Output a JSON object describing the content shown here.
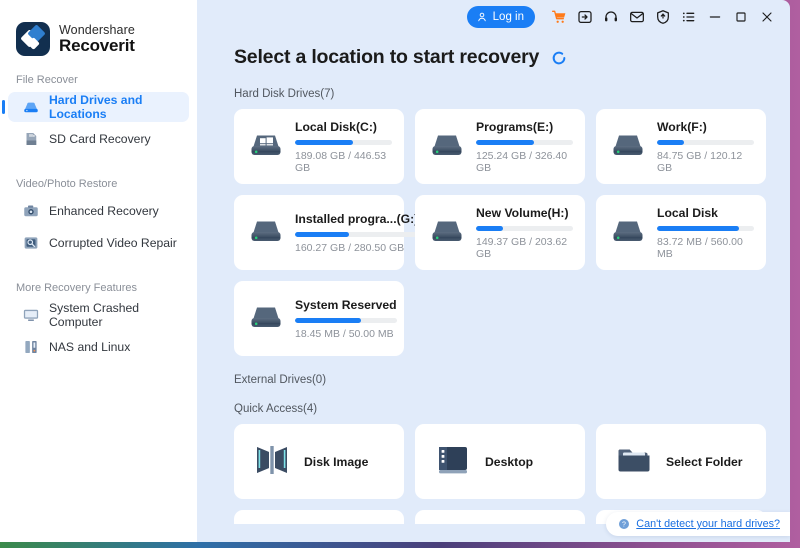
{
  "titlebar": {
    "login_label": "Log in",
    "icons": [
      {
        "name": "cart-icon",
        "label": "Cart"
      },
      {
        "name": "activate-icon",
        "label": "Activate"
      },
      {
        "name": "headset-support-icon",
        "label": "Support"
      },
      {
        "name": "mail-icon",
        "label": "Feedback"
      },
      {
        "name": "update-shield-icon",
        "label": "Update"
      },
      {
        "name": "menu-list-icon",
        "label": "Menu"
      },
      {
        "name": "minimize-icon",
        "label": "Minimize"
      },
      {
        "name": "maximize-icon",
        "label": "Maximize"
      },
      {
        "name": "close-icon",
        "label": "Close"
      }
    ]
  },
  "sidebar": {
    "brand_line1": "Wondershare",
    "brand_line2": "Recoverit",
    "sections": [
      {
        "label": "File Recover",
        "items": [
          {
            "label": "Hard Drives and Locations",
            "icon": "hard-drive-icon",
            "active": true
          },
          {
            "label": "SD Card Recovery",
            "icon": "sd-card-icon",
            "active": false
          }
        ]
      },
      {
        "label": "Video/Photo Restore",
        "items": [
          {
            "label": "Enhanced Recovery",
            "icon": "camera-icon",
            "active": false
          },
          {
            "label": "Corrupted Video Repair",
            "icon": "video-repair-icon",
            "active": false
          }
        ]
      },
      {
        "label": "More Recovery Features",
        "items": [
          {
            "label": "System Crashed Computer",
            "icon": "monitor-icon",
            "active": false
          },
          {
            "label": "NAS and Linux",
            "icon": "nas-server-icon",
            "active": false
          }
        ]
      }
    ]
  },
  "main": {
    "title": "Select a location to start recovery",
    "refresh_icon": "refresh-icon",
    "groups": {
      "hard_disk_label": "Hard Disk Drives(7)",
      "external_label": "External Drives(0)",
      "quick_access_label": "Quick Access(4)"
    },
    "drives": [
      {
        "name": "Local Disk(C:)",
        "capacity": "189.08 GB / 446.53 GB",
        "percent": 60,
        "icon": "windows-drive-icon"
      },
      {
        "name": "Programs(E:)",
        "capacity": "125.24 GB / 326.40 GB",
        "percent": 60,
        "icon": "drive-icon"
      },
      {
        "name": "Work(F:)",
        "capacity": "84.75 GB / 120.12 GB",
        "percent": 28,
        "icon": "drive-icon"
      },
      {
        "name": "Installed progra...(G:)",
        "capacity": "160.27 GB / 280.50 GB",
        "percent": 44,
        "icon": "drive-icon"
      },
      {
        "name": "New Volume(H:)",
        "capacity": "149.37 GB / 203.62 GB",
        "percent": 28,
        "icon": "drive-icon"
      },
      {
        "name": "Local Disk",
        "capacity": "83.72 MB / 560.00 MB",
        "percent": 85,
        "icon": "drive-icon"
      },
      {
        "name": "System Reserved",
        "capacity": "18.45 MB / 50.00 MB",
        "percent": 65,
        "icon": "drive-icon"
      }
    ],
    "quick_access": [
      {
        "label": "Disk Image",
        "icon": "disk-image-icon"
      },
      {
        "label": "Desktop",
        "icon": "desktop-icon"
      },
      {
        "label": "Select Folder",
        "icon": "folder-icon"
      }
    ],
    "help": {
      "icon": "question-mark-icon",
      "text": "Can't detect your hard drives?"
    }
  },
  "colors": {
    "accent": "#1a7ef5",
    "cart": "#ff7a18",
    "main_bg": "#e1ebfa",
    "sidebar_bg": "#ffffff",
    "logo_navy": "#122f4f"
  }
}
